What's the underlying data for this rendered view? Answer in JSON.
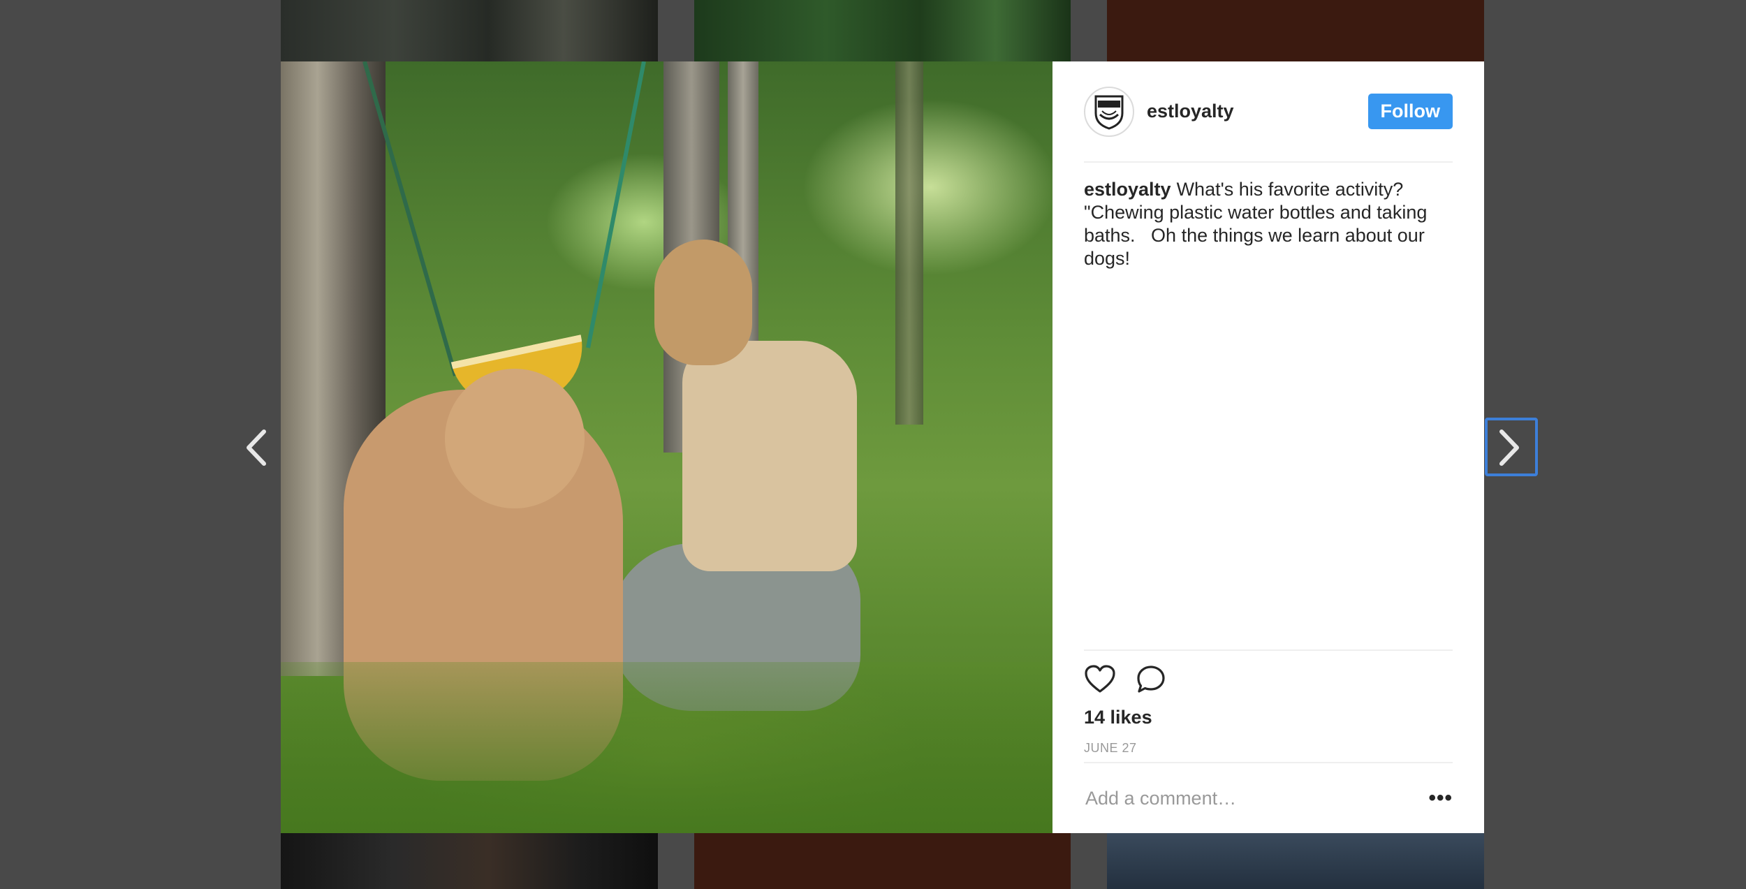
{
  "post": {
    "username": "estloyalty",
    "follow_label": "Follow",
    "avatar_text": "Est. Loyalty",
    "caption_user": "estloyalty",
    "caption_text": "What's his favorite activity? \"Chewing plastic water bottles and taking baths.   Oh the things we learn about our dogs!",
    "likes": "14 likes",
    "date": "JUNE 27",
    "comment_placeholder": "Add a comment…",
    "more_label": "•••"
  },
  "nav": {
    "prev_label": "‹",
    "next_label": "›"
  },
  "icons": {
    "like": "heart-icon",
    "comment": "comment-bubble-icon",
    "prev": "chevron-left-icon",
    "next": "chevron-right-icon"
  },
  "colors": {
    "follow_button": "#3897f0",
    "focus_ring": "#3d7fd9",
    "backdrop": "#494949"
  }
}
